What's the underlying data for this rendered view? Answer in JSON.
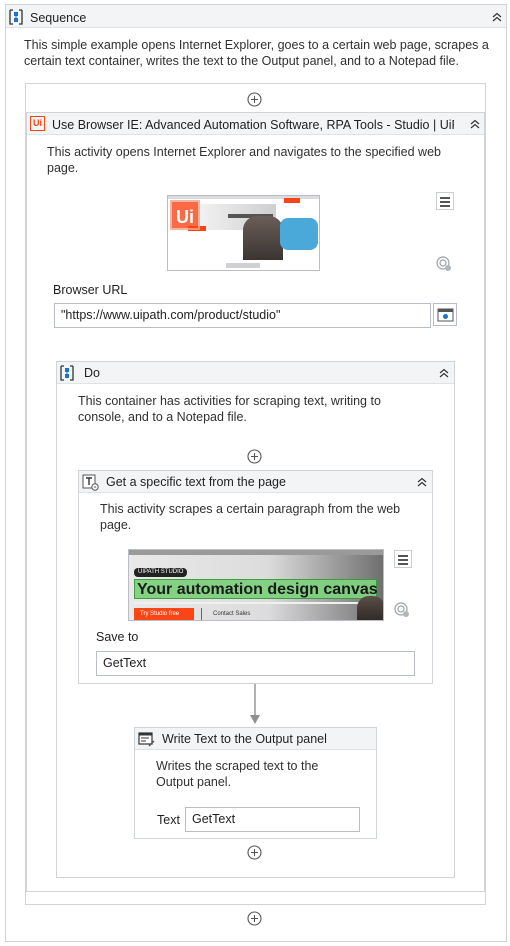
{
  "sequence": {
    "title": "Sequence",
    "description": "This simple example opens Internet Explorer, goes to a certain web page, scrapes a certain text container, writes the text to the Output panel, and to a Notepad file."
  },
  "browser": {
    "title": "Use Browser IE: Advanced Automation Software, RPA Tools - Studio | UiPath",
    "description": "This activity opens Internet Explorer and navigates to the specified web page.",
    "url_label": "Browser URL",
    "url_value": "\"https://www.uipath.com/product/studio\""
  },
  "do": {
    "title": "Do",
    "description": "This container has activities for scraping text, writing to console, and to a Notepad file."
  },
  "get_text": {
    "title": "Get a specific text from the page",
    "description": "This activity scrapes a certain paragraph from the web page.",
    "save_label": "Save to",
    "save_value": "GetText",
    "preview": {
      "badge": "UIPATH STUDIO",
      "headline": "Your automation design canvas",
      "button_text": "Try Studio free",
      "link_text": "Contact Sales"
    }
  },
  "write_text": {
    "title": "Write Text to the Output panel",
    "description": "Writes the scraped text to the Output panel.",
    "text_label": "Text",
    "text_value": "GetText"
  },
  "colors": {
    "accent": "#1a73c8",
    "uipath_orange": "#fa4616",
    "header_bg": "#f3f4f6",
    "border": "#cfd4d9"
  }
}
